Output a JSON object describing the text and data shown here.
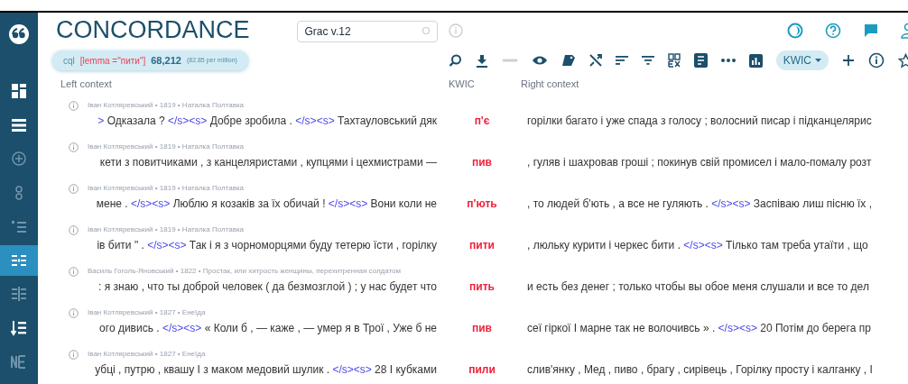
{
  "header": {
    "title": "CONCORDANCE",
    "corpus_field": {
      "value": "Grac v.12"
    }
  },
  "query": {
    "label": "cql",
    "expression": "[lemma =\"пити\"]",
    "count": "68,212",
    "per_million": "(82.85 per million)"
  },
  "view_mode": {
    "label": "KWIC"
  },
  "sidebar": {
    "items": [
      {
        "selected": false
      },
      {
        "selected": false
      },
      {
        "selected": false
      },
      {
        "selected": false
      },
      {
        "selected": false
      },
      {
        "selected": true
      },
      {
        "selected": false
      },
      {
        "selected": false
      },
      {
        "selected": false
      }
    ]
  },
  "table": {
    "columns": [
      "Left context",
      "KWIC",
      "Right context"
    ],
    "rows": [
      {
        "meta": "Іван Котляревський • 1819 • Наталка Полтавка",
        "kwic": "п'є",
        "left": [
          {
            "kind": "tag",
            "text": ">"
          },
          {
            "kind": "text",
            "text": " Одказала ? "
          },
          {
            "kind": "tag",
            "text": "</s><s>"
          },
          {
            "kind": "text",
            "text": " Добре зробила . "
          },
          {
            "kind": "tag",
            "text": "</s><s>"
          },
          {
            "kind": "text",
            "text": " Тахтауловський дяк"
          }
        ],
        "right": [
          {
            "kind": "text",
            "text": "горілки багато і уже спада з голосу ; волосний писар і підканцелярис"
          }
        ]
      },
      {
        "meta": "Іван Котляревський • 1819 • Наталка Полтавка",
        "kwic": "пив",
        "left": [
          {
            "kind": "text",
            "text": "кети з повитчиками , з канцеляристами , купцями і цехмистрами —"
          }
        ],
        "right": [
          {
            "kind": "text",
            "text": ", гуляв і шахровав гроші ; покинув свій промисел і мало-помалу розт"
          }
        ]
      },
      {
        "meta": "Іван Котляревський • 1819 • Наталка Полтавка",
        "kwic": "п'ють",
        "left": [
          {
            "kind": "text",
            "text": "мене . "
          },
          {
            "kind": "tag",
            "text": "</s><s>"
          },
          {
            "kind": "text",
            "text": " Люблю я козаків за їх обичай ! "
          },
          {
            "kind": "tag",
            "text": "</s><s>"
          },
          {
            "kind": "text",
            "text": " Вони коли не"
          }
        ],
        "right": [
          {
            "kind": "text",
            "text": ", то людей б'ють , а все не гуляють . "
          },
          {
            "kind": "tag",
            "text": "</s><s>"
          },
          {
            "kind": "text",
            "text": " Заспіваю лиш пісню їх ,"
          }
        ]
      },
      {
        "meta": "Іван Котляревський • 1819 • Наталка Полтавка",
        "kwic": "пити",
        "left": [
          {
            "kind": "text",
            "text": "ів бити \" . "
          },
          {
            "kind": "tag",
            "text": "</s><s>"
          },
          {
            "kind": "text",
            "text": " Так і я з чорноморцями буду тетерю їсти , горілку"
          }
        ],
        "right": [
          {
            "kind": "text",
            "text": ", люльку курити і черкес бити . "
          },
          {
            "kind": "tag",
            "text": "</s><s>"
          },
          {
            "kind": "text",
            "text": " Тілько там треба утаїти , що"
          }
        ]
      },
      {
        "meta": "Василь Гоголь-Яновський • 1822 • Простак, или хитрость женщины, перехитренная солдатом",
        "kwic": "пить",
        "left": [
          {
            "kind": "text",
            "text": ": я знаю , что ты доброй человек ( да безмозглой ) ; у нас будет что"
          }
        ],
        "right": [
          {
            "kind": "text",
            "text": "и есть без денег ; только чтобы вы обое меня слушали и все то дел"
          }
        ]
      },
      {
        "meta": "Іван Котляревський • 1827 • Енеїда",
        "kwic": "пив",
        "left": [
          {
            "kind": "text",
            "text": "ого дивись . "
          },
          {
            "kind": "tag",
            "text": "</s><s>"
          },
          {
            "kind": "text",
            "text": " « Коли б , — каже , — умер я в Трої , Уже б не"
          }
        ],
        "right": [
          {
            "kind": "text",
            "text": "сеї гіркої І марне так не волочивсь » . "
          },
          {
            "kind": "tag",
            "text": "</s><s>"
          },
          {
            "kind": "text",
            "text": " 20 Потім до берега пр"
          }
        ]
      },
      {
        "meta": "Іван Котляревський • 1827 • Енеїда",
        "kwic": "пили",
        "left": [
          {
            "kind": "text",
            "text": "убці , путрю , квашу І з маком медовий шулик . "
          },
          {
            "kind": "tag",
            "text": "</s><s>"
          },
          {
            "kind": "text",
            "text": " 28 І кубками"
          }
        ],
        "right": [
          {
            "kind": "text",
            "text": "слив'янку , Мед , пиво , брагу , сирівець , Горілку просту і калганку , І"
          }
        ]
      }
    ]
  }
}
